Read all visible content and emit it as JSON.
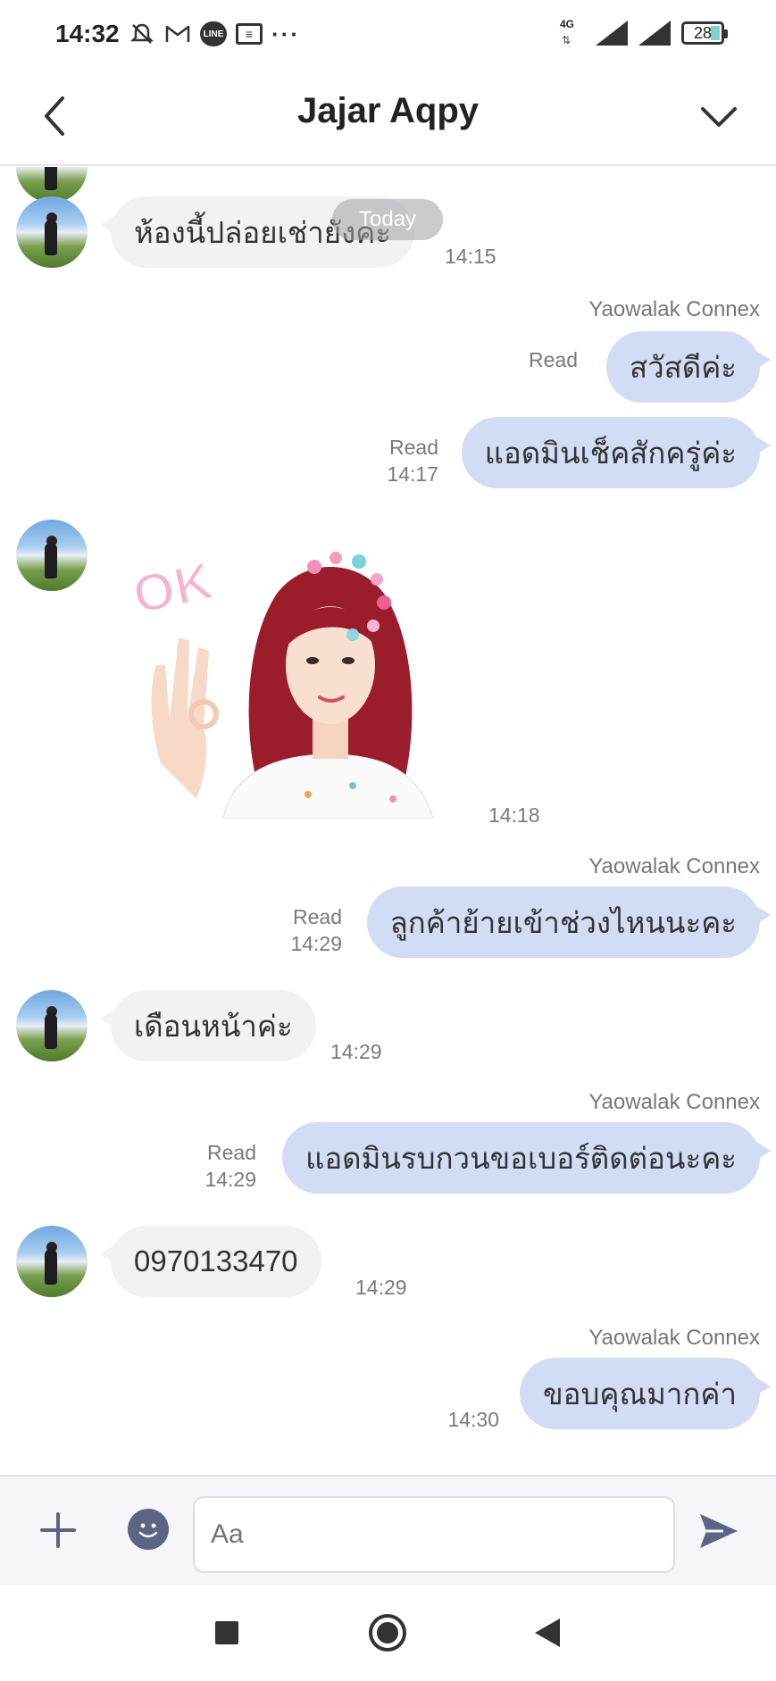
{
  "status_bar": {
    "time": "14:32",
    "icons": [
      "mute-icon",
      "gmail-icon",
      "line-icon",
      "note-icon",
      "more-dots-icon"
    ],
    "network": "4G",
    "battery": "28"
  },
  "header": {
    "title": "Jajar Aqpy"
  },
  "chat": {
    "date_chip": "Today",
    "messages": [
      {
        "direction": "in",
        "text": "ห้องนี้ปล่อยเช่ายังคะ",
        "time": "14:15"
      },
      {
        "direction": "out",
        "sender": "Yaowalak Connex",
        "text": "สวัสดีค่ะ",
        "status": "Read",
        "time": ""
      },
      {
        "direction": "out",
        "sender": "",
        "text": "แอดมินเช็คสักครู่ค่ะ",
        "status": "Read",
        "time": "14:17"
      },
      {
        "direction": "in",
        "type": "sticker",
        "text": "OK",
        "time": "14:18"
      },
      {
        "direction": "out",
        "sender": "Yaowalak Connex",
        "text": "ลูกค้าย้ายเข้าช่วงไหนนะคะ",
        "status": "Read",
        "time": "14:29"
      },
      {
        "direction": "in",
        "text": "เดือนหน้าค่ะ",
        "time": "14:29"
      },
      {
        "direction": "out",
        "sender": "Yaowalak Connex",
        "text": "แอดมินรบกวนขอเบอร์ติดต่อนะคะ",
        "status": "Read",
        "time": "14:29"
      },
      {
        "direction": "in",
        "text": "0970133470",
        "time": "14:29"
      },
      {
        "direction": "out",
        "sender": "Yaowalak Connex",
        "text": "ขอบคุณมากค่า",
        "status": "",
        "time": "14:30"
      }
    ]
  },
  "input_bar": {
    "placeholder": "Aa"
  },
  "colors": {
    "incoming_bubble": "#f2f2f5",
    "outgoing_bubble": "#d3dcf5",
    "icon_accent": "#5c6483"
  }
}
